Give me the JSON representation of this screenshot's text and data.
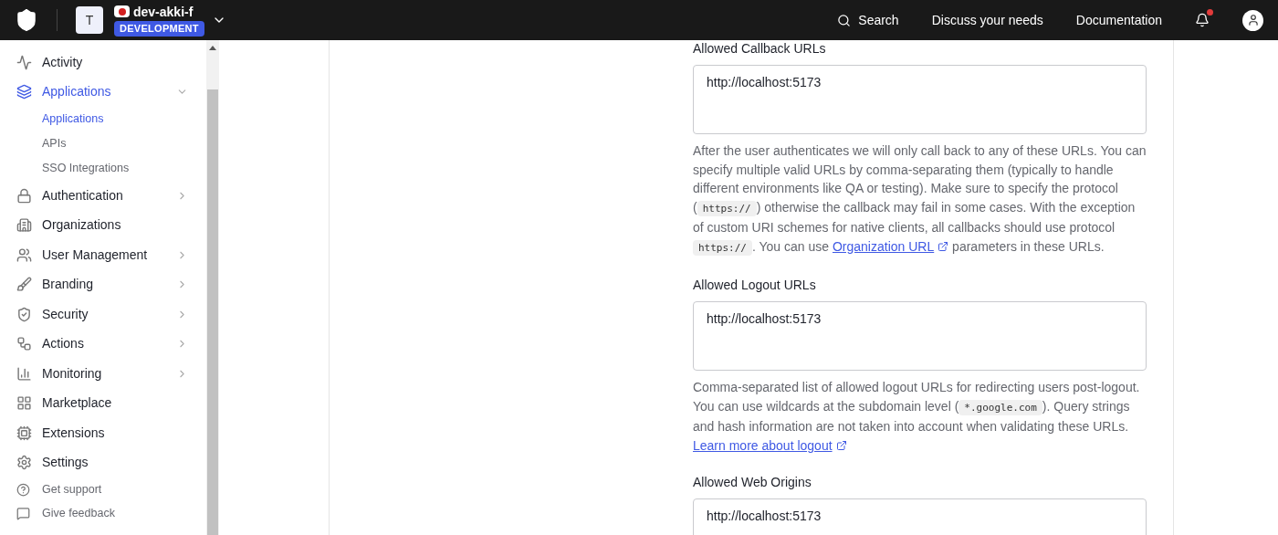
{
  "header": {
    "tenant_initial": "T",
    "tenant_name": "dev-akki-f",
    "environment": "DEVELOPMENT",
    "links": [
      "Search",
      "Discuss your needs",
      "Documentation"
    ],
    "notification_dot": true
  },
  "sidebar": {
    "items": [
      {
        "label": "Activity",
        "selected": false
      },
      {
        "label": "Applications",
        "selected": true,
        "expanded": true,
        "children": [
          {
            "label": "Applications",
            "selected": true
          },
          {
            "label": "APIs",
            "selected": false
          },
          {
            "label": "SSO Integrations",
            "selected": false
          }
        ]
      },
      {
        "label": "Authentication",
        "selected": false,
        "expanded": false
      },
      {
        "label": "Organizations",
        "selected": false
      },
      {
        "label": "User Management",
        "selected": false,
        "expanded": false
      },
      {
        "label": "Branding",
        "selected": false,
        "expanded": false
      },
      {
        "label": "Security",
        "selected": false,
        "expanded": false
      },
      {
        "label": "Actions",
        "selected": false,
        "expanded": false
      },
      {
        "label": "Monitoring",
        "selected": false,
        "expanded": false
      },
      {
        "label": "Marketplace",
        "selected": false
      },
      {
        "label": "Extensions",
        "selected": false
      },
      {
        "label": "Settings",
        "selected": false
      }
    ],
    "footer": [
      "Get support",
      "Give feedback"
    ]
  },
  "fields": [
    {
      "label": "Allowed Callback URLs",
      "value": "http://localhost:5173",
      "help": [
        {
          "kind": "text",
          "text": "After the user authenticates we will only call back to any of these URLs. You can specify multiple valid URLs by comma-separating them (typically to handle different environments like QA or testing). Make sure to specify the protocol ("
        },
        {
          "kind": "code",
          "text": "https://"
        },
        {
          "kind": "text",
          "text": ") otherwise the callback may fail in some cases. With the exception of custom URI schemes for native clients, all callbacks should use protocol "
        },
        {
          "kind": "code",
          "text": "https://"
        },
        {
          "kind": "text",
          "text": ". You can use "
        },
        {
          "kind": "link",
          "text": "Organization URL"
        },
        {
          "kind": "text",
          "text": " parameters in these URLs."
        }
      ]
    },
    {
      "label": "Allowed Logout URLs",
      "value": "http://localhost:5173",
      "help": [
        {
          "kind": "text",
          "text": "Comma-separated list of allowed logout URLs for redirecting users post-logout. You can use wildcards at the subdomain level ("
        },
        {
          "kind": "code",
          "text": "*.google.com"
        },
        {
          "kind": "text",
          "text": "). Query strings and hash information are not taken into account when validating these URLs. "
        },
        {
          "kind": "link",
          "text": "Learn more about logout"
        }
      ]
    },
    {
      "label": "Allowed Web Origins",
      "value": "http://localhost:5173"
    }
  ]
}
